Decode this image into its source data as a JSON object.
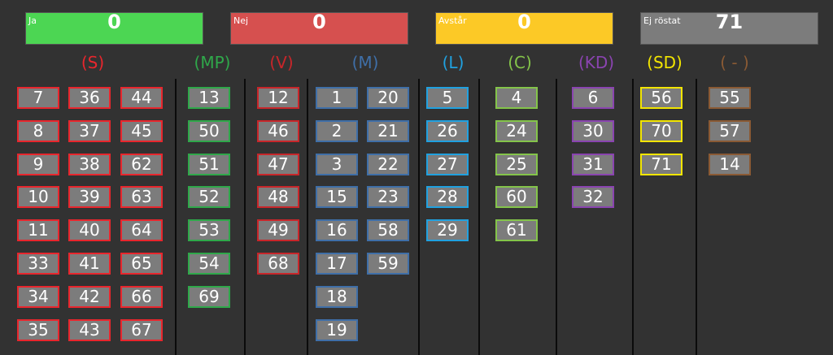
{
  "tallies": [
    {
      "label": "Ja",
      "count": "0",
      "color": "#4cd653"
    },
    {
      "label": "Nej",
      "count": "0",
      "color": "#d6504f"
    },
    {
      "label": "Avstår",
      "count": "0",
      "color": "#fcc926"
    },
    {
      "label": "Ej röstat",
      "count": "71",
      "color": "#7c7c7c"
    }
  ],
  "parties": [
    {
      "name": "(S)",
      "color": "#e8262d",
      "cols": [
        [
          "7",
          "8",
          "9",
          "10",
          "11",
          "33",
          "34",
          "35"
        ],
        [
          "36",
          "37",
          "38",
          "39",
          "40",
          "41",
          "42",
          "43"
        ],
        [
          "44",
          "45",
          "62",
          "63",
          "64",
          "65",
          "66",
          "67"
        ]
      ]
    },
    {
      "name": "(MP)",
      "color": "#2fa84a",
      "cols": [
        [
          "13",
          "50",
          "51",
          "52",
          "53",
          "54",
          "69"
        ]
      ]
    },
    {
      "name": "(V)",
      "color": "#c8262a",
      "cols": [
        [
          "12",
          "46",
          "47",
          "48",
          "49",
          "68"
        ]
      ]
    },
    {
      "name": "(M)",
      "color": "#3f6fa8",
      "cols": [
        [
          "1",
          "2",
          "3",
          "15",
          "16",
          "17",
          "18",
          "19"
        ],
        [
          "20",
          "21",
          "22",
          "23",
          "58",
          "59"
        ]
      ]
    },
    {
      "name": "(L)",
      "color": "#20a1e0",
      "cols": [
        [
          "5",
          "26",
          "27",
          "28",
          "29"
        ]
      ]
    },
    {
      "name": "(C)",
      "color": "#84c44a",
      "cols": [
        [
          "4",
          "24",
          "25",
          "60",
          "61"
        ]
      ]
    },
    {
      "name": "(KD)",
      "color": "#8a44b0",
      "cols": [
        [
          "6",
          "30",
          "31",
          "32"
        ]
      ]
    },
    {
      "name": "(SD)",
      "color": "#f2e500",
      "cols": [
        [
          "56",
          "70",
          "71"
        ]
      ]
    },
    {
      "name": "( - )",
      "color": "#8a5a34",
      "cols": [
        [
          "55",
          "57",
          "14"
        ]
      ]
    }
  ]
}
